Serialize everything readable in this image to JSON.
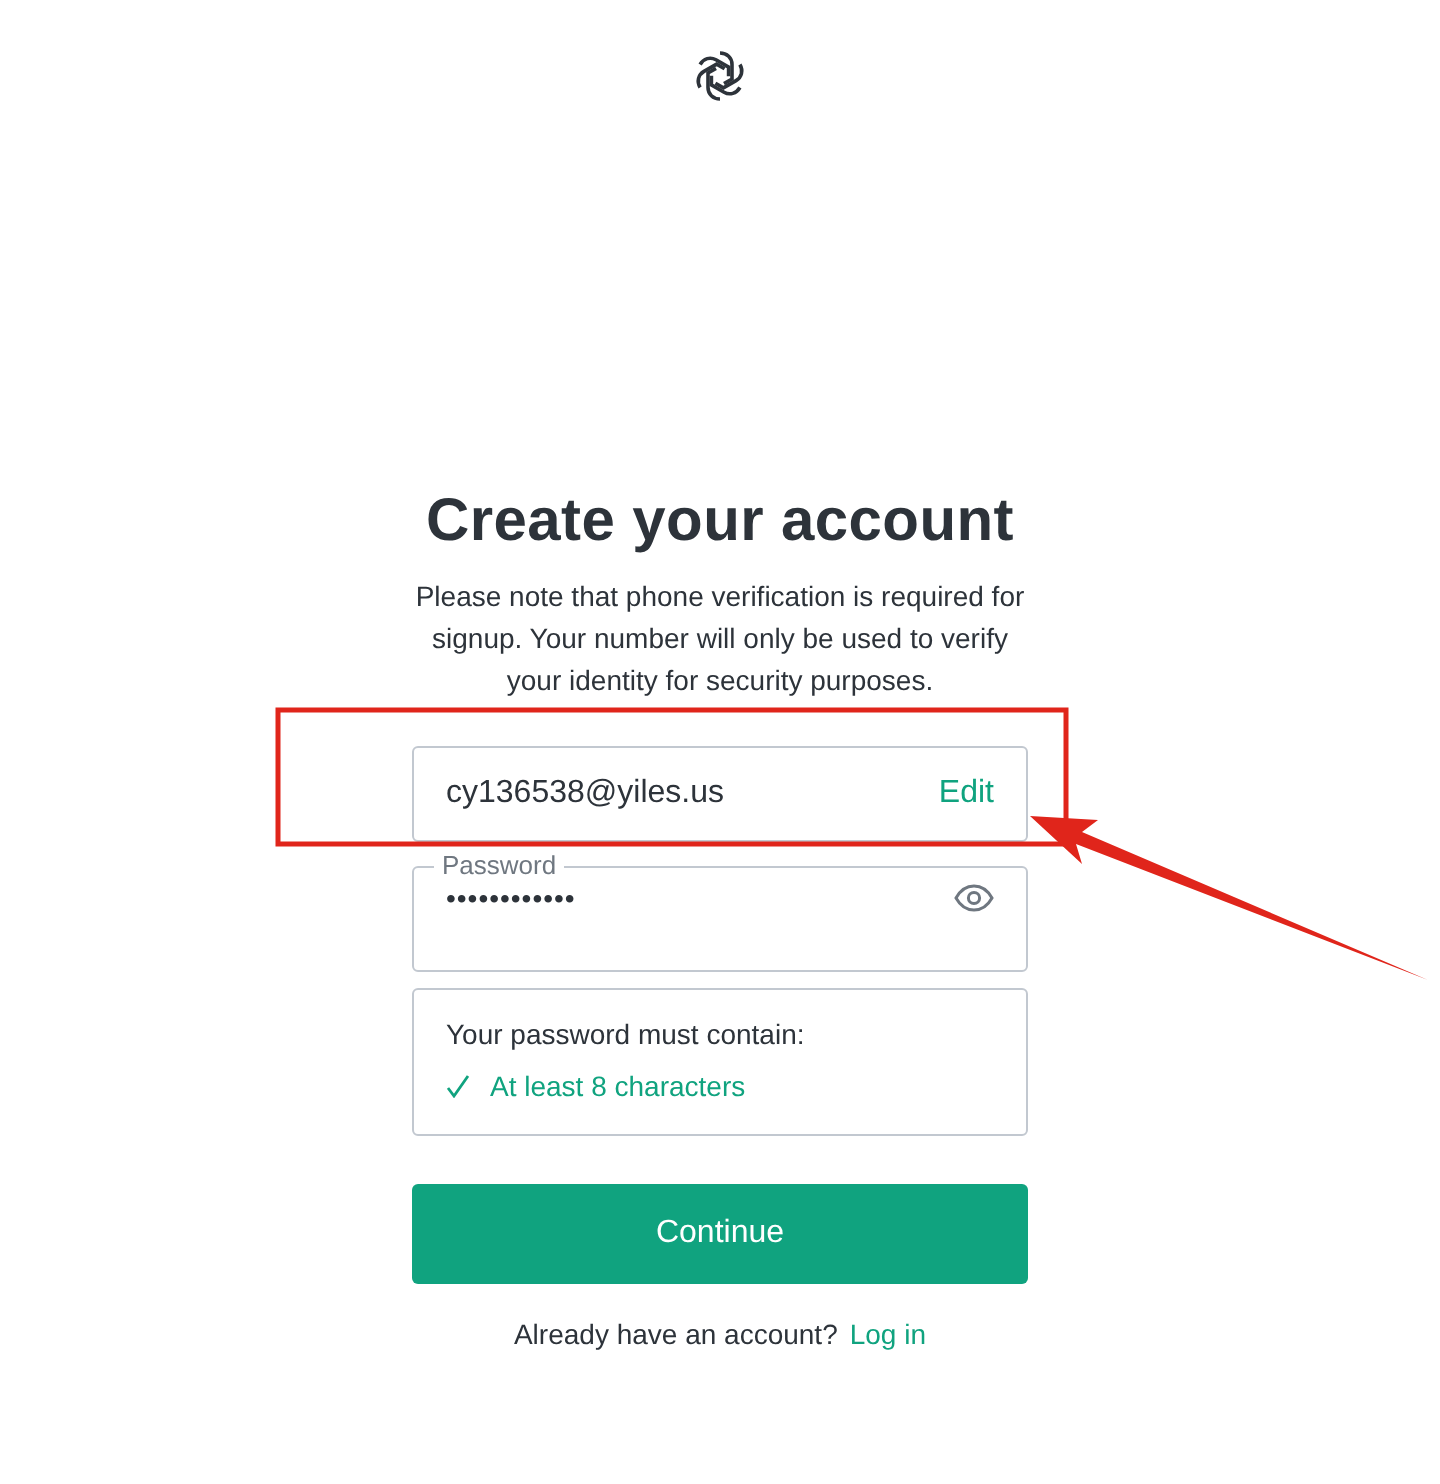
{
  "title": "Create your account",
  "notice": "Please note that phone verification is required for signup. Your number will only be used to verify your identity for security purposes.",
  "email_field": {
    "value": "cy136538@yiles.us",
    "action": "Edit"
  },
  "password_field": {
    "label": "Password",
    "value": "••••••••••••"
  },
  "requirements": {
    "heading": "Your password must contain:",
    "items": [
      {
        "text": "At least 8 characters",
        "met": true
      }
    ]
  },
  "continue_button": "Continue",
  "login_prompt": {
    "text": "Already have an account?",
    "link": "Log in"
  },
  "annotation": {
    "highlight_box": true,
    "arrow": true
  }
}
